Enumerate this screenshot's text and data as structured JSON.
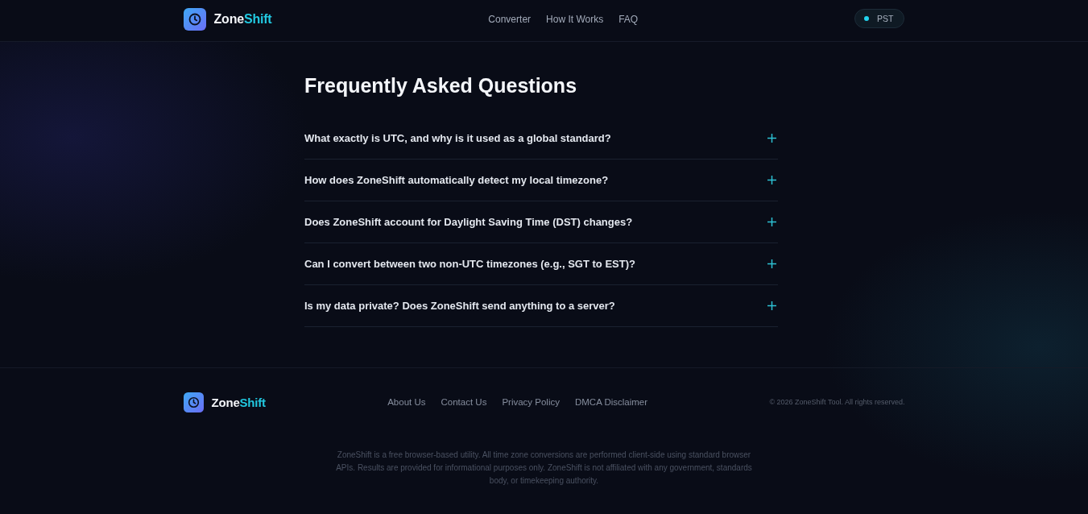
{
  "header": {
    "brand": {
      "name": "Zone",
      "accent": "Shift"
    },
    "nav": [
      "Converter",
      "How It Works",
      "FAQ"
    ],
    "timezone_badge": {
      "label": "PST"
    }
  },
  "faq": {
    "title": "Frequently Asked Questions",
    "items": [
      {
        "question": "What exactly is UTC, and why is it used as a global standard?",
        "expanded": false
      },
      {
        "question": "How does ZoneShift automatically detect my local timezone?",
        "expanded": false
      },
      {
        "question": "Does ZoneShift account for Daylight Saving Time (DST) changes?",
        "expanded": false
      },
      {
        "question": "Can I convert between two non-UTC timezones (e.g., SGT to EST)?",
        "expanded": false
      },
      {
        "question": "Is my data private? Does ZoneShift send anything to a server?",
        "expanded": false
      }
    ]
  },
  "footer": {
    "brand": {
      "name": "Zone",
      "accent": "Shift"
    },
    "links": [
      "About Us",
      "Contact Us",
      "Privacy Policy",
      "DMCA Disclaimer"
    ],
    "copyright": "© 2026 ZoneShift Tool. All rights reserved.",
    "disclaimer": "ZoneShift is a free browser-based utility. All time zone conversions are performed client-side using standard browser APIs. Results are provided for informational purposes only. ZoneShift is not affiliated with any government, standards body, or timekeeping authority."
  }
}
